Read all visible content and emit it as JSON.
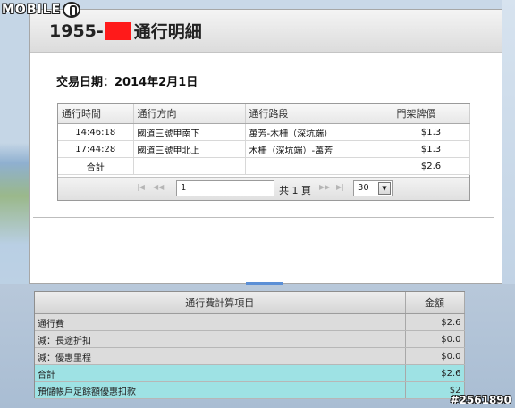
{
  "watermark": {
    "brand": "MOBILE",
    "post_id": "#2561890"
  },
  "header": {
    "title_prefix": "1955-",
    "title_suffix": "通行明細"
  },
  "date_line": "交易日期：2014年2月1日",
  "trips": {
    "columns": [
      "通行時間",
      "通行方向",
      "通行路段",
      "門架牌價"
    ],
    "rows": [
      {
        "time": "14:46:18",
        "direction": "國道三號甲南下",
        "section": "萬芳-木柵（深坑端）",
        "price": "$1.3"
      },
      {
        "time": "17:44:28",
        "direction": "國道三號甲北上",
        "section": "木柵（深坑端）-萬芳",
        "price": "$1.3"
      }
    ],
    "total": {
      "label": "合計",
      "price": "$2.6"
    }
  },
  "pager": {
    "first": "|◀",
    "prev": "◀◀",
    "page_value": "1",
    "total_pages": "共 1 頁",
    "next": "▶▶",
    "last": "▶|",
    "page_size": "30"
  },
  "fee": {
    "columns": [
      "通行費計算項目",
      "金額"
    ],
    "rows": [
      {
        "label": "通行費",
        "amount": "$2.6",
        "highlight": false
      },
      {
        "label": "減：長途折扣",
        "amount": "$0.0",
        "highlight": false
      },
      {
        "label": "減：優惠里程",
        "amount": "$0.0",
        "highlight": false
      },
      {
        "label": "合計",
        "amount": "$2.6",
        "highlight": true
      },
      {
        "label": "預儲帳戶足餘額優惠扣款",
        "amount": "$2",
        "highlight": true
      }
    ]
  },
  "colors": {
    "highlight_row": "#9ee2e4",
    "redaction": "#ff1a1a",
    "accent": "#5b8fd6"
  }
}
